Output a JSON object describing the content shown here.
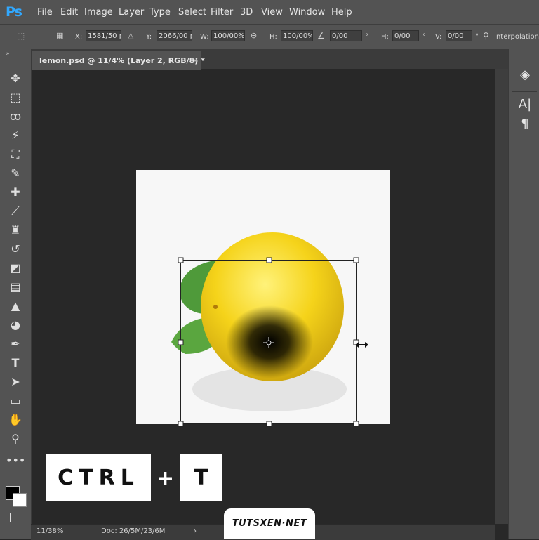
{
  "app": {
    "logo": "Ps"
  },
  "menu": [
    "File",
    "Edit",
    "Image",
    "Layer",
    "Type",
    "Select",
    "Filter",
    "3D",
    "View",
    "Window",
    "Help"
  ],
  "options": {
    "x_label": "X:",
    "x_value": "1581/50 p:",
    "y_label": "Y:",
    "y_value": "2066/00 p:",
    "w_label": "W:",
    "w_value": "100/00%",
    "h_label": "H:",
    "h_value": "100/00%",
    "rot_value": "0/00",
    "hskew_label": "H:",
    "hskew_value": "0/00",
    "vskew_label": "V:",
    "vskew_value": "0/00",
    "degree_symbol": "°",
    "interpolation_label": "Interpolation"
  },
  "document": {
    "tab_title": "lemon.psd @ 11/4% (Layer 2, RGB/8) *",
    "close": "×"
  },
  "status": {
    "zoom": "11/38%",
    "doc_info": "Doc: 26/5M/23/6M",
    "arrow": "›"
  },
  "overlay": {
    "key1": "CTRL",
    "plus": "+",
    "key2": "T"
  },
  "watermark": "TUTSXEN·NET",
  "tools": [
    "move-tool",
    "marquee-tool",
    "lasso-tool",
    "magic-wand-tool",
    "crop-tool",
    "eyedropper-tool",
    "healing-brush-tool",
    "brush-tool",
    "clone-stamp-tool",
    "history-brush-tool",
    "eraser-tool",
    "gradient-tool",
    "blur-tool",
    "dodge-tool",
    "pen-tool",
    "type-tool",
    "path-selection-tool",
    "rectangle-tool",
    "hand-tool",
    "zoom-tool",
    "more-tools"
  ],
  "right_panel": [
    "layers-icon",
    "character-icon",
    "paragraph-icon"
  ],
  "colors": {
    "accent": "#31a8ff",
    "ui_bg": "#535353",
    "workspace": "#282828",
    "lemon": "#f5d31a",
    "leaf": "#4f9a3a"
  }
}
